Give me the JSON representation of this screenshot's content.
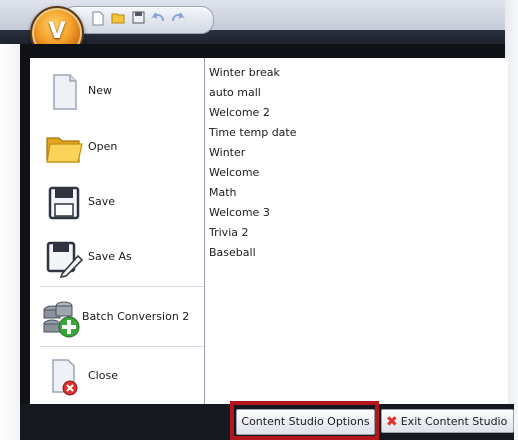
{
  "quick_access": {
    "icons": [
      "new-file-icon",
      "open-folder-icon",
      "save-icon",
      "undo-icon",
      "redo-icon"
    ]
  },
  "app_menu": {
    "items": [
      {
        "label": "New",
        "icon": "new-file-icon"
      },
      {
        "label": "Open",
        "icon": "open-folder-icon"
      },
      {
        "label": "Save",
        "icon": "save-icon"
      },
      {
        "label": "Save As",
        "icon": "save-as-icon"
      },
      {
        "label": "Batch Conversion 2",
        "icon": "batch-conversion-icon"
      },
      {
        "label": "Close",
        "icon": "close-document-icon"
      }
    ]
  },
  "recent_documents": [
    "Winter break",
    "auto mall",
    "Welcome 2",
    "Time temp date",
    "Winter",
    "Welcome",
    "Math",
    "Welcome 3",
    "Trivia 2",
    "Baseball"
  ],
  "footer": {
    "options_label": "Content Studio Options",
    "exit_label": "Exit Content Studio"
  },
  "colors": {
    "highlight_border": "#b3171b",
    "exit_icon": "#e0302b",
    "orb": "#f3a12a"
  }
}
